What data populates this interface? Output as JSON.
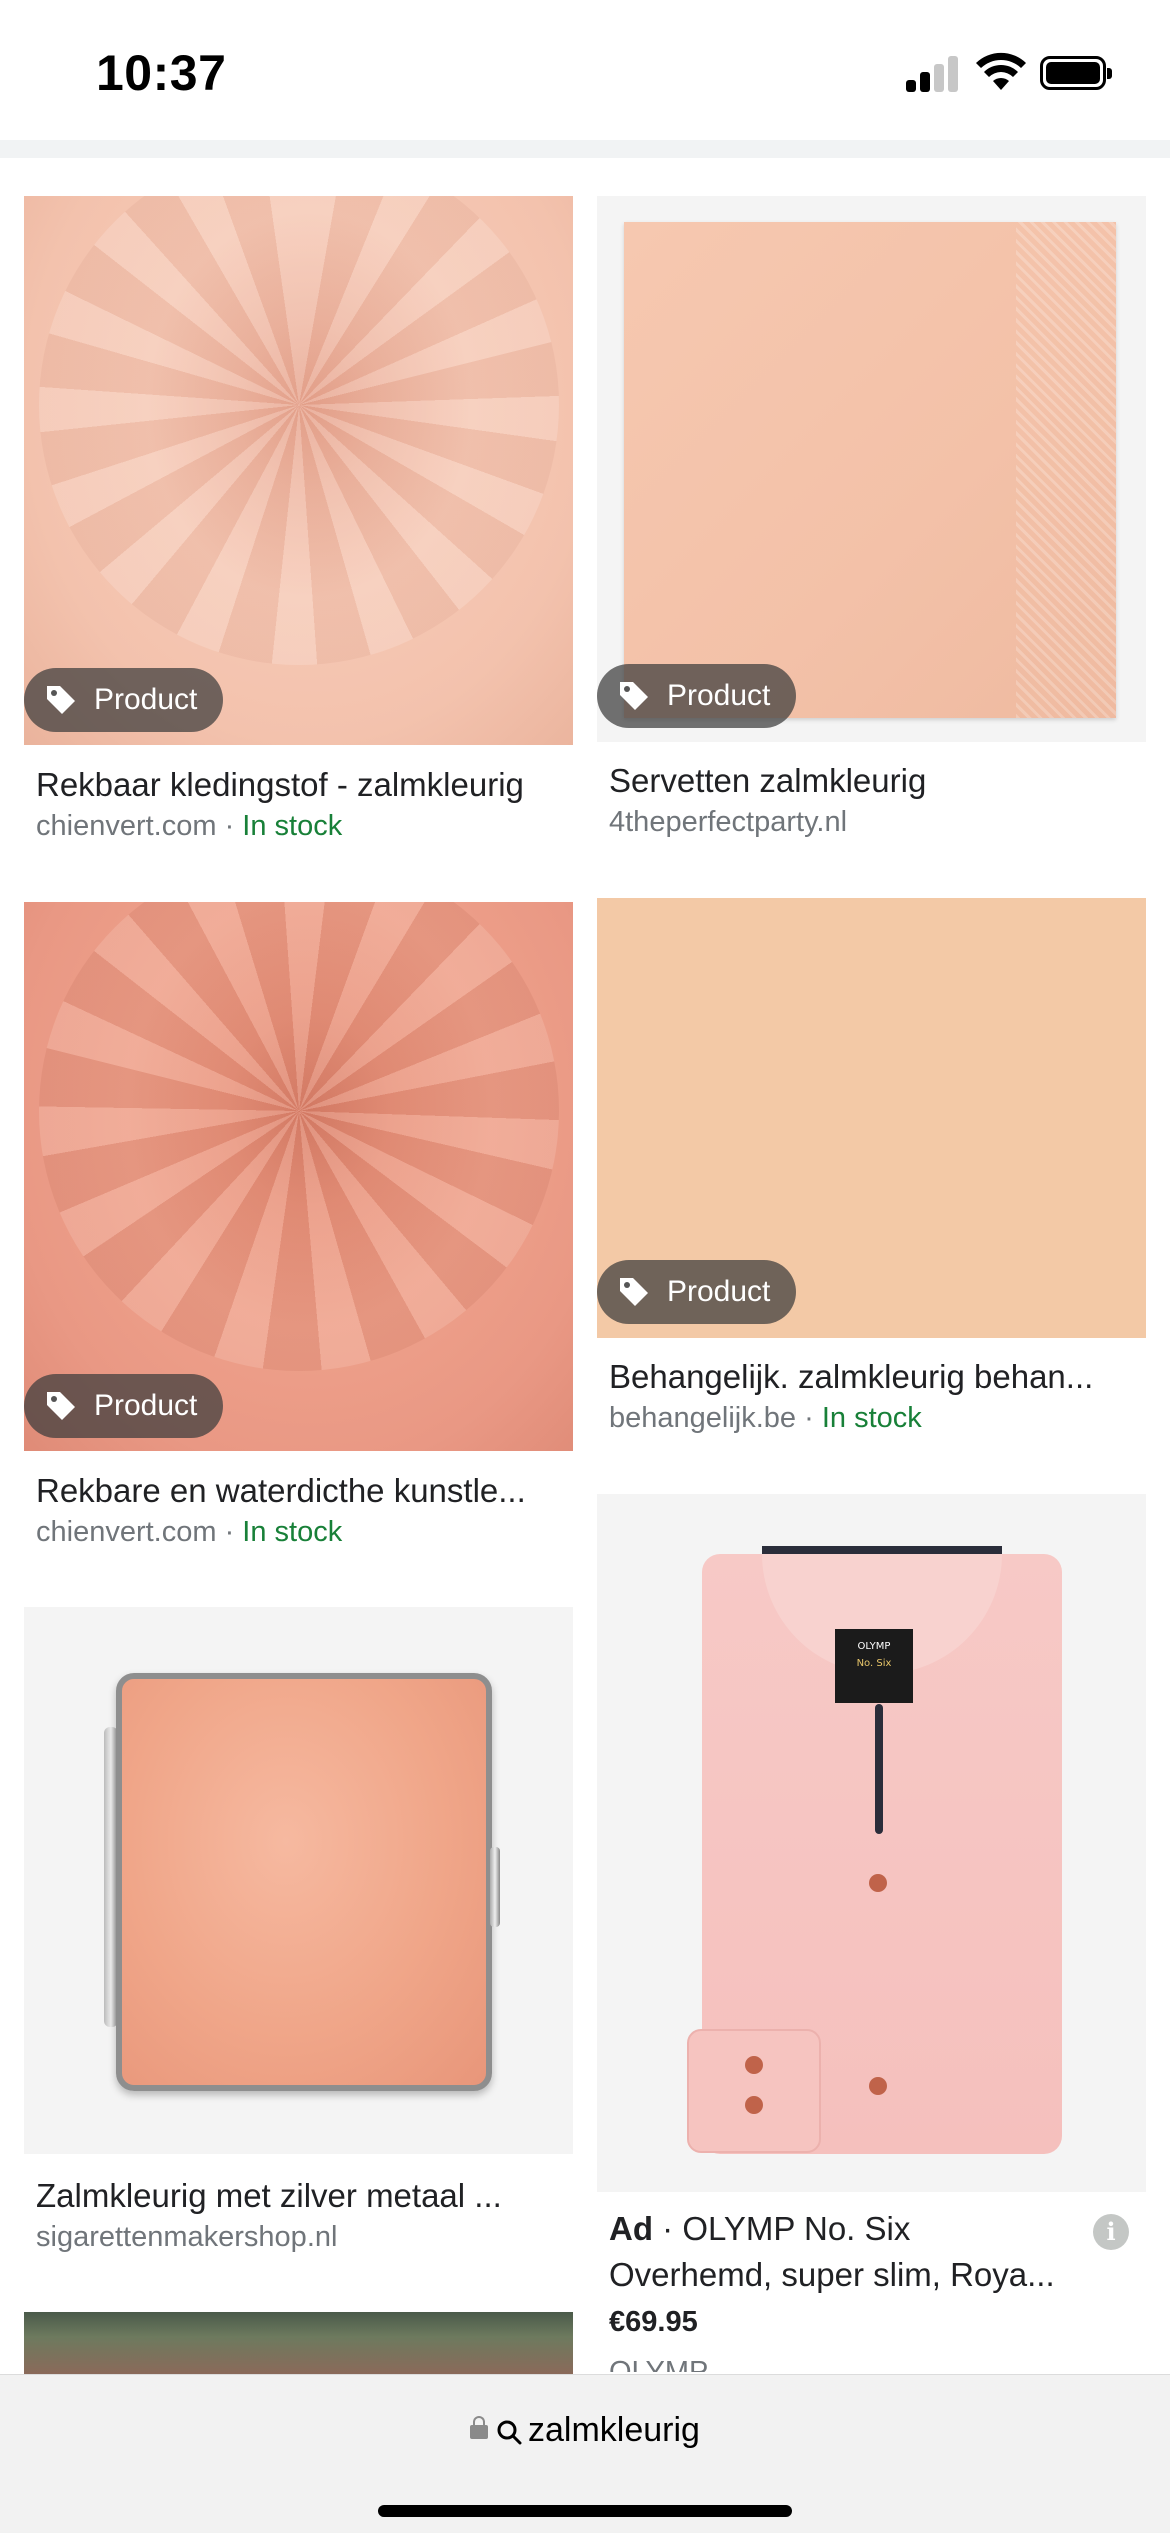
{
  "status_bar": {
    "time": "10:37"
  },
  "results": [
    {
      "badge": "Product",
      "title": "Rekbaar kledingstof - zalmkleurig",
      "source": "chienvert.com",
      "separator": " · ",
      "stock": "In stock"
    },
    {
      "badge": "Product",
      "title": "Servetten zalmkleurig",
      "source": "4theperfectparty.nl"
    },
    {
      "badge": "Product",
      "title": "Rekbare en waterdicthe kunstle...",
      "source": "chienvert.com",
      "separator": " · ",
      "stock": "In stock"
    },
    {
      "badge": "Product",
      "title": "Behangelijk. zalmkleurig behan...",
      "source": "behangelijk.be",
      "separator": " · ",
      "stock": "In stock"
    },
    {
      "title": "Zalmkleurig met zilver metaal ...",
      "source": "sigarettenmakershop.nl"
    }
  ],
  "ad": {
    "label": "Ad",
    "separator": " · ",
    "title_line1": "OLYMP No. Six",
    "title_line2": "Overhemd, super slim, Roya...",
    "price": "€69.95",
    "merchant": "OLYMP",
    "info_glyph": "i"
  },
  "shirt_label": {
    "brand": "OLYMP",
    "line": "No. Six"
  },
  "bottom_bar": {
    "address": "zalmkleurig"
  },
  "colors": {
    "in_stock": "#188038",
    "secondary_text": "#70757a",
    "badge_bg": "rgba(60,60,60,0.72)"
  }
}
